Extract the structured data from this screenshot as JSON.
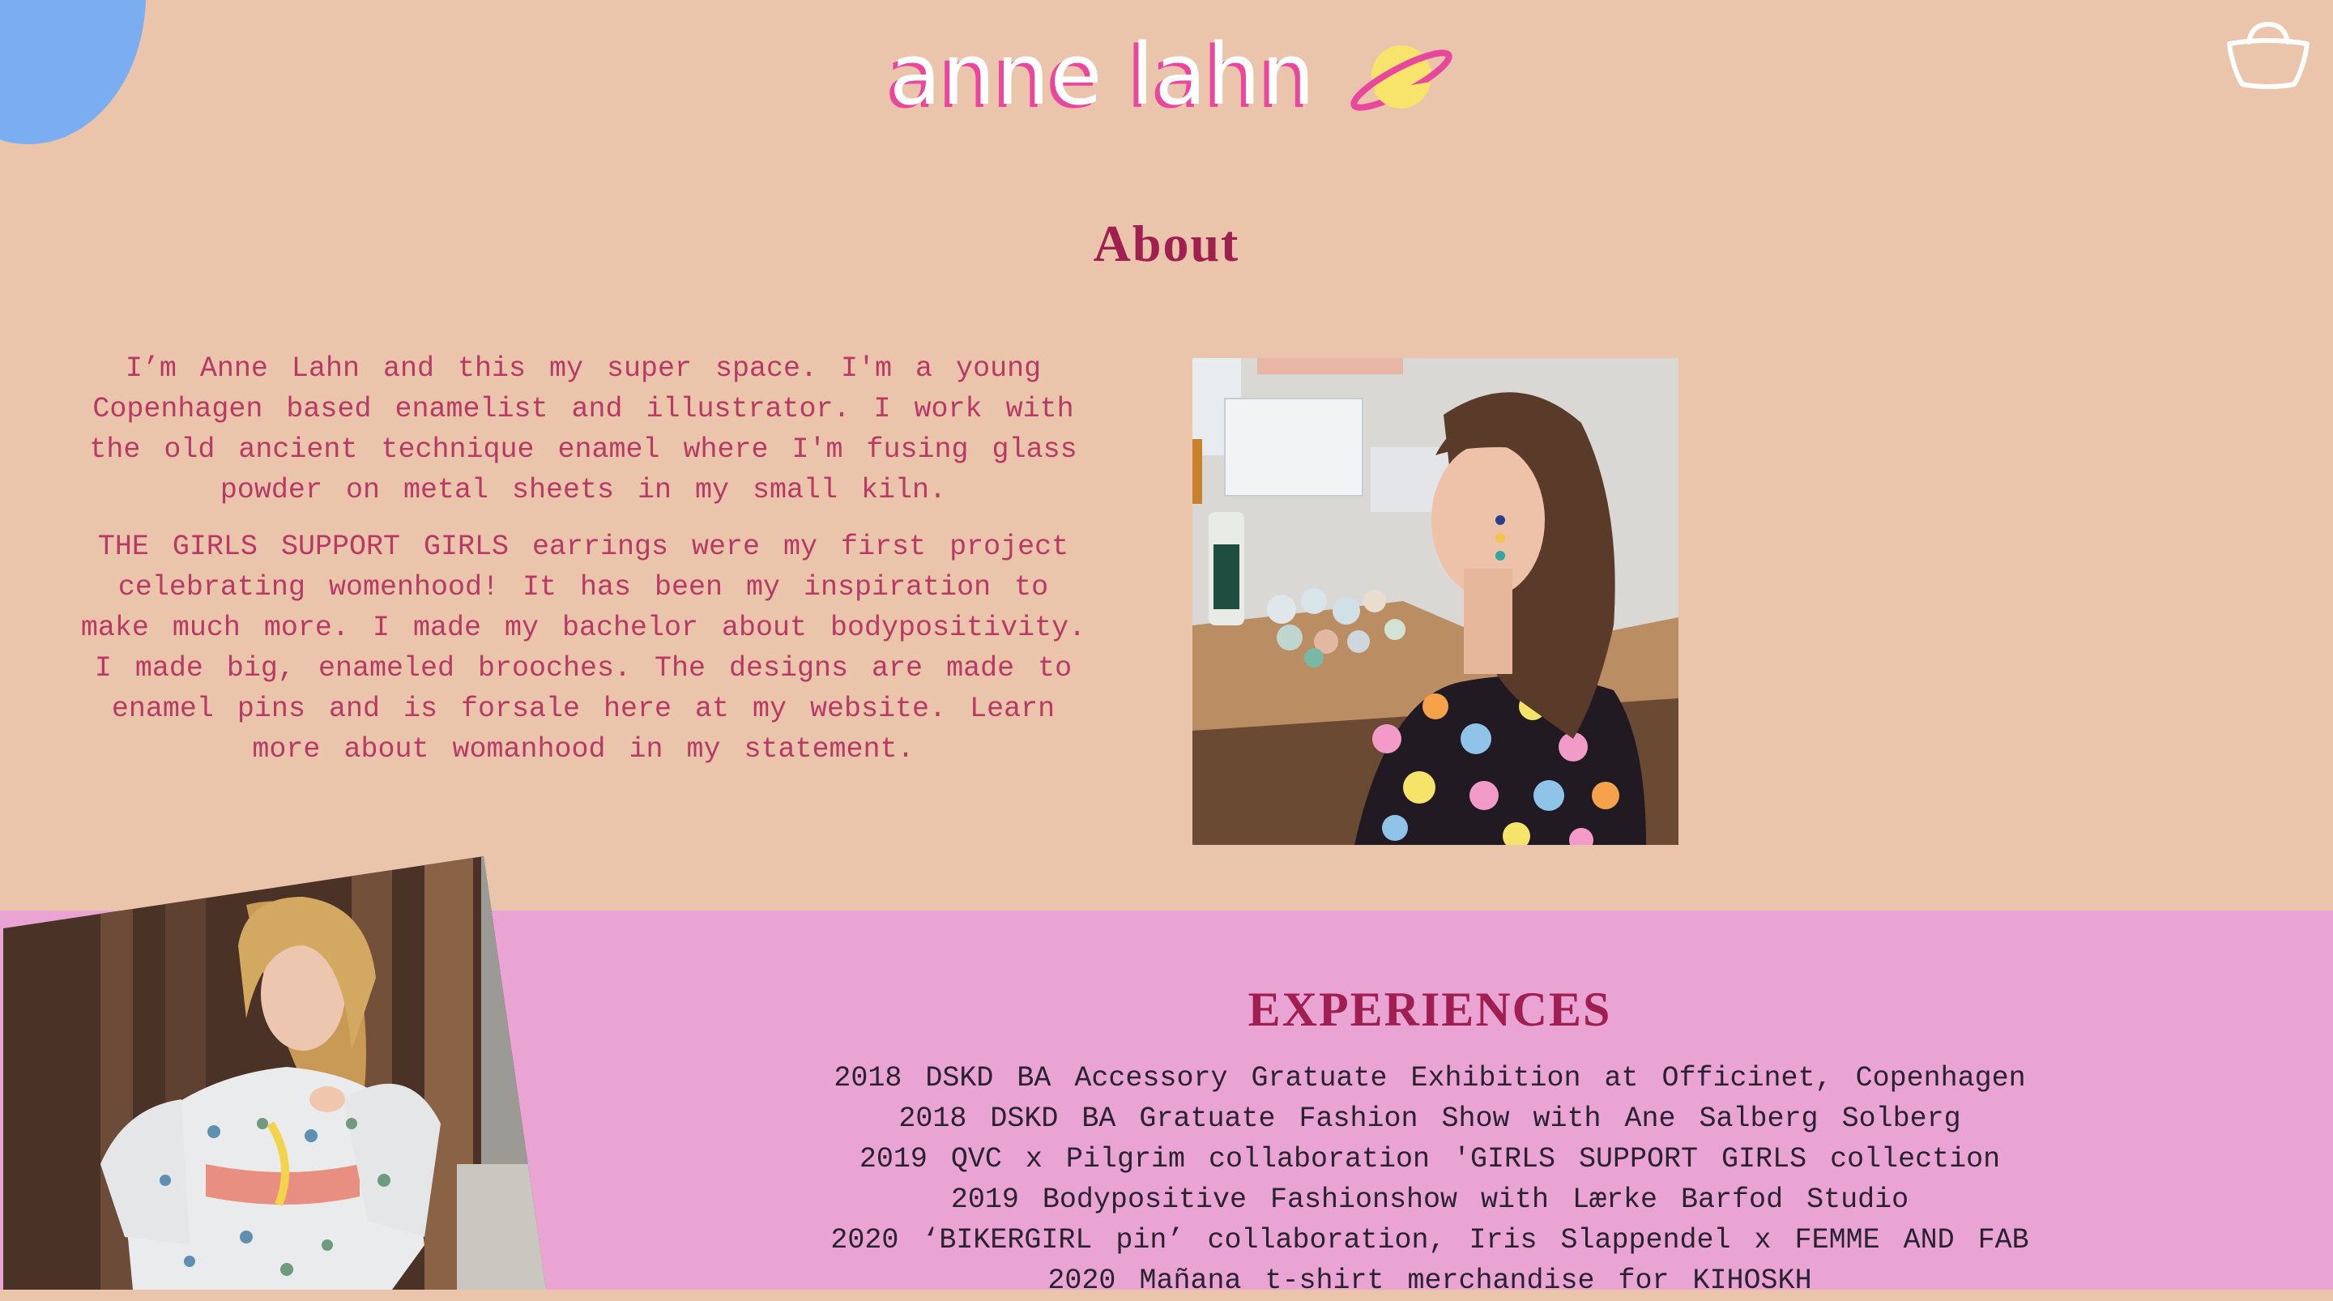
{
  "header": {
    "logo_text": "anne lahn",
    "logo_icon": "planet-icon",
    "cart_icon": "basket-icon"
  },
  "about": {
    "title": "About",
    "paragraphs": [
      "I’m Anne Lahn and this my super space. I'm a young Copenhagen based enamelist and illustrator. I work with the old ancient technique enamel where I'm fusing glass powder on metal sheets in my small kiln.",
      "THE GIRLS SUPPORT GIRLS earrings were my first project celebrating womenhood! It has been my inspiration to make much more. I made my bachelor about bodypositivity. I made big, enameled brooches. The designs are made to enamel pins and is forsale here at my website. Learn more about womanhood in my statement."
    ]
  },
  "experiences": {
    "title": "EXPERIENCES",
    "items": [
      "2018 DSKD BA Accessory Gratuate Exhibition at Officinet, Copenhagen",
      "2018 DSKD BA Gratuate Fashion Show with Ane Salberg Solberg",
      "2019 QVC x Pilgrim collaboration 'GIRLS SUPPORT GIRLS collection",
      "2019 Bodypositive Fashionshow with Lærke Barfod Studio",
      "2020 ‘BIKERGIRL pin’ collaboration, Iris Slappendel x FEMME AND FAB",
      "2020 Mañana t-shirt merchandise for KIHOSKH"
    ]
  },
  "colors": {
    "background": "#eac4ab",
    "accent": "#9e1f50",
    "body_text": "#b83a64",
    "pink_section": "#e9a4d4",
    "blue_circle": "#7aaef0"
  }
}
